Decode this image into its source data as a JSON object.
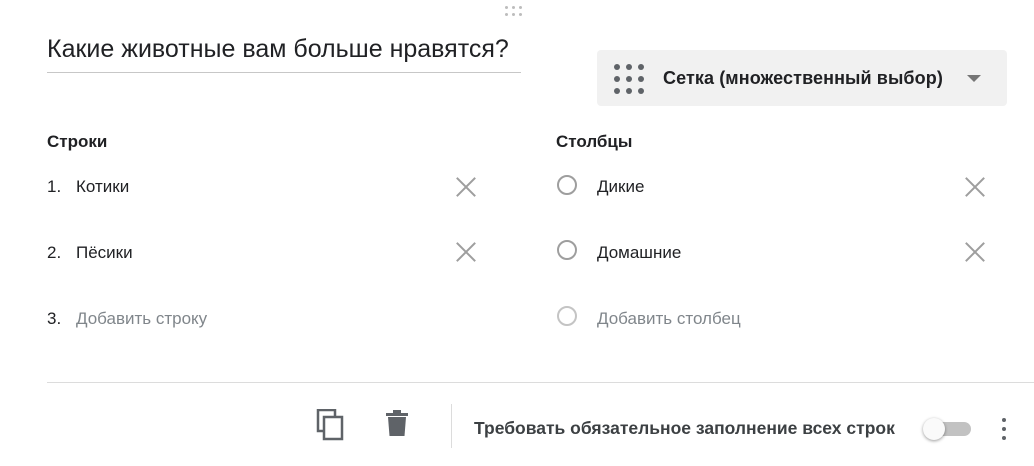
{
  "question": {
    "title": "Какие животные вам больше нравятся?"
  },
  "type_select": {
    "icon": "grid-icon",
    "label": "Сетка (множественный выбор)",
    "arrow_icon": "dropdown-arrow-icon"
  },
  "rows": {
    "heading": "Строки",
    "items": [
      {
        "num": "1.",
        "label": "Котики"
      },
      {
        "num": "2.",
        "label": "Пёсики"
      }
    ],
    "add": {
      "num": "3.",
      "label": "Добавить строку"
    }
  },
  "columns": {
    "heading": "Столбцы",
    "items": [
      {
        "label": "Дикие"
      },
      {
        "label": "Домашние"
      }
    ],
    "add": {
      "label": "Добавить столбец"
    }
  },
  "footer": {
    "copy_icon": "copy-icon",
    "delete_icon": "trash-icon",
    "required_label": "Требовать обязательное заполнение всех строк",
    "required_on": false,
    "more_icon": "more-vert-icon"
  },
  "colors": {
    "accent_grey": "#5f6368",
    "select_bg": "#f1f1f1",
    "placeholder": "#80868b"
  }
}
